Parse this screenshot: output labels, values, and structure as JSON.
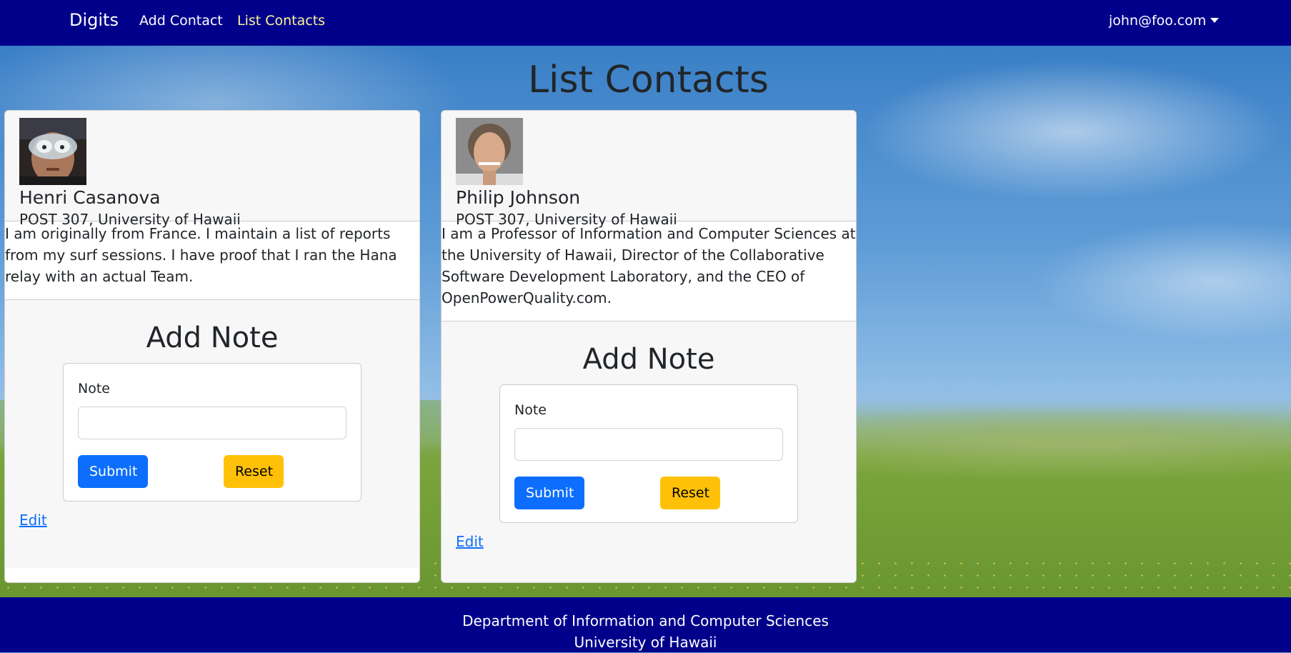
{
  "navbar": {
    "brand": "Digits",
    "links": [
      {
        "label": "Add Contact"
      },
      {
        "label": "List Contacts"
      }
    ],
    "user": "john@foo.com"
  },
  "page": {
    "title": "List Contacts"
  },
  "contacts": [
    {
      "name": "Henri Casanova",
      "address": "POST 307, University of Hawaii",
      "description": "I am originally from France. I maintain a list of reports from my surf sessions. I have proof that I ran the Hana relay with an actual Team.",
      "note_title": "Add Note",
      "note_label": "Note",
      "note_value": "",
      "submit_label": "Submit",
      "reset_label": "Reset",
      "edit_label": "Edit"
    },
    {
      "name": "Philip Johnson",
      "address": "POST 307, University of Hawaii",
      "description": "I am a Professor of Information and Computer Sciences at the University of Hawaii, Director of the Collaborative Software Development Laboratory, and the CEO of OpenPowerQuality.com.",
      "note_title": "Add Note",
      "note_label": "Note",
      "note_value": "",
      "submit_label": "Submit",
      "reset_label": "Reset",
      "edit_label": "Edit"
    }
  ],
  "footer": {
    "line1": "Department of Information and Computer Sciences",
    "line2": "University of Hawaii"
  },
  "colors": {
    "navbar": "#00008b",
    "active_link": "#fff59a",
    "submit": "#0d6efd",
    "reset": "#ffc107"
  }
}
